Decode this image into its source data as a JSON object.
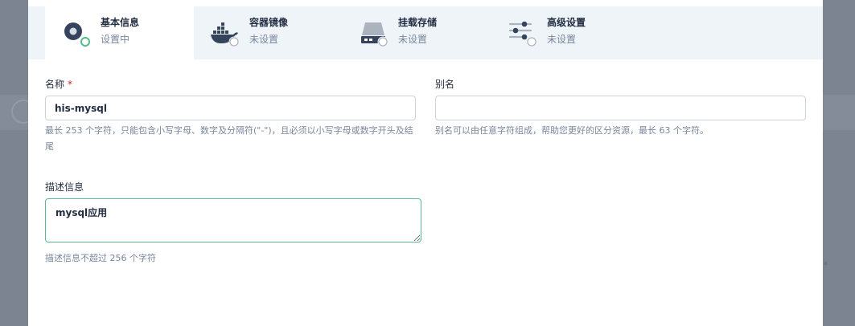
{
  "steps": [
    {
      "title": "基本信息",
      "status": "设置中",
      "icon": "basic-info-icon"
    },
    {
      "title": "容器镜像",
      "status": "未设置",
      "icon": "docker-icon"
    },
    {
      "title": "挂载存储",
      "status": "未设置",
      "icon": "storage-icon"
    },
    {
      "title": "高级设置",
      "status": "未设置",
      "icon": "settings-sliders-icon"
    }
  ],
  "form": {
    "name": {
      "label": "名称",
      "required_mark": "*",
      "value": "his-mysql",
      "hint": "最长 253 个字符，只能包含小写字母、数字及分隔符(\"-\")，且必须以小写字母或数字开头及结尾"
    },
    "alias": {
      "label": "别名",
      "value": "",
      "hint": "别名可以由任意字符组成，帮助您更好的区分资源，最长 63 个字符。"
    },
    "description": {
      "label": "描述信息",
      "value": "mysql应用",
      "hint": "描述信息不超过 256 个字符"
    }
  },
  "background": {
    "trailing_char": "。"
  },
  "colors": {
    "accent_green": "#55bc8a",
    "active_step_bg": "#ffffff",
    "steps_bg": "#eff4f9",
    "overlay": "#7c8391",
    "required": "#ca2621"
  }
}
